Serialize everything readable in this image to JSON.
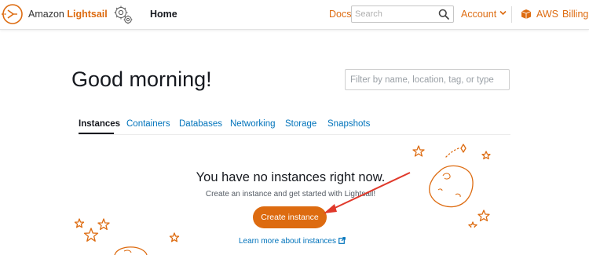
{
  "nav": {
    "brand_prefix": "Amazon ",
    "brand_accent": "Lightsail",
    "home_label": "Home",
    "docs_label": "Docs",
    "search_placeholder": "Search",
    "account_label": "Account",
    "aws_label": "AWS",
    "billing_label": "Billing"
  },
  "greeting": "Good morning!",
  "filter": {
    "placeholder": "Filter by name, location, tag, or type"
  },
  "tabs": [
    {
      "label": "Instances",
      "active": true
    },
    {
      "label": "Containers",
      "active": false
    },
    {
      "label": "Databases",
      "active": false
    },
    {
      "label": "Networking",
      "active": false
    },
    {
      "label": "Storage",
      "active": false
    },
    {
      "label": "Snapshots",
      "active": false
    }
  ],
  "empty_state": {
    "title": "You have no instances right now.",
    "subtitle": "Create an instance and get started with Lightsail!",
    "create_button": "Create instance",
    "learn_more": "Learn more about instances"
  },
  "icons": {
    "logo": "lightsail-logo-icon",
    "settings": "gear-icon",
    "search": "search-icon",
    "account_chevron": "chevron-down-icon",
    "aws": "aws-box-icon",
    "external": "external-link-icon"
  },
  "colors": {
    "accent": "#dd6b10",
    "link": "#0073bb",
    "text": "#16191f",
    "annotation_arrow": "#e0392b"
  }
}
